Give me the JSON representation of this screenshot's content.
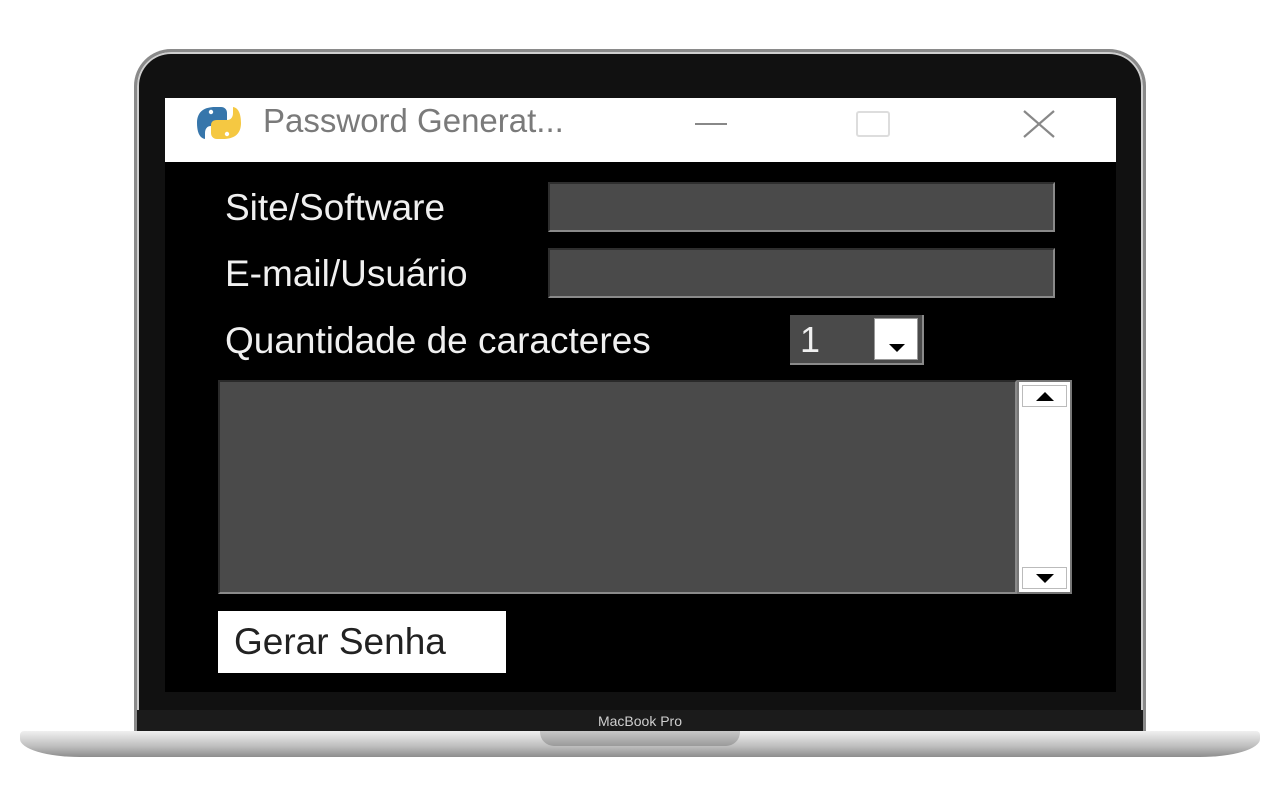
{
  "window": {
    "title": "Password Generat...",
    "icon": "python-icon"
  },
  "form": {
    "site_label": "Site/Software",
    "site_value": "",
    "email_label": "E-mail/Usuário",
    "email_value": "",
    "length_label": "Quantidade de caracteres",
    "length_value": "1",
    "output_value": "",
    "generate_button": "Gerar Senha"
  },
  "device": {
    "model": "MacBook Pro"
  }
}
